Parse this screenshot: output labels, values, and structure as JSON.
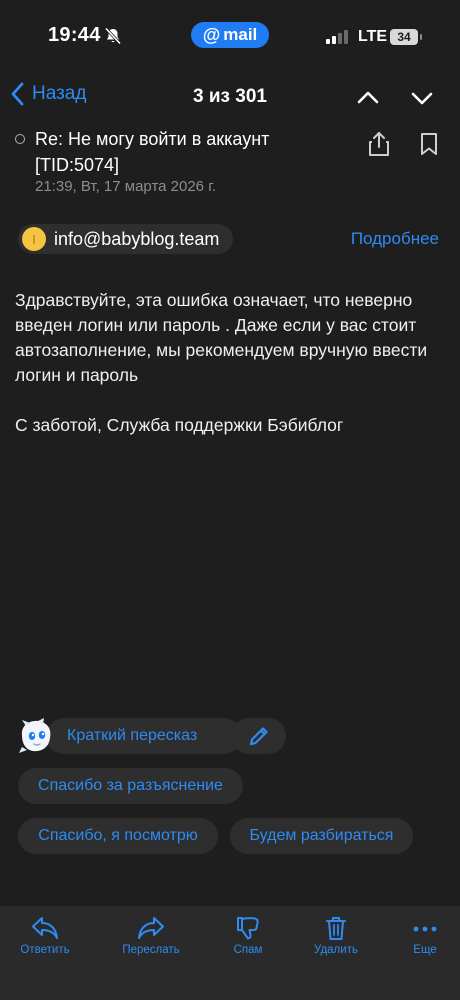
{
  "status_bar": {
    "time": "19:44",
    "app_badge": "mail",
    "network": "LTE",
    "battery": "34"
  },
  "nav": {
    "back_label": "Назад",
    "counter": "3 из 301"
  },
  "email": {
    "subject": "Re: Не могу войти в аккаунт [TID:5074]",
    "date": "21:39, Вт, 17 марта 2026 г.",
    "sender_initial": "I",
    "sender": "info@babyblog.team",
    "details_label": "Подробнее",
    "body": "Здравствуйте, эта ошибка означает, что неверно введен логин или пароль . Даже если у вас стоит автозаполнение, мы рекомендуем вручную ввести логин и пароль",
    "signature": "С заботой, Служба поддержки Бэбиблог"
  },
  "assistant": {
    "summary_label": "Краткий пересказ",
    "quick_replies": [
      "Спасибо за разъяснение",
      "Спасибо, я посмотрю",
      "Будем разбираться"
    ]
  },
  "toolbar": {
    "reply": "Ответить",
    "forward": "Переслать",
    "spam": "Спам",
    "delete": "Удалить",
    "more": "Еще"
  },
  "colors": {
    "background": "#1e1e1e",
    "accent": "#2e8bf2",
    "badge": "#1f7cf2",
    "chip": "#2e2e2e",
    "avatar": "#f4c542"
  }
}
